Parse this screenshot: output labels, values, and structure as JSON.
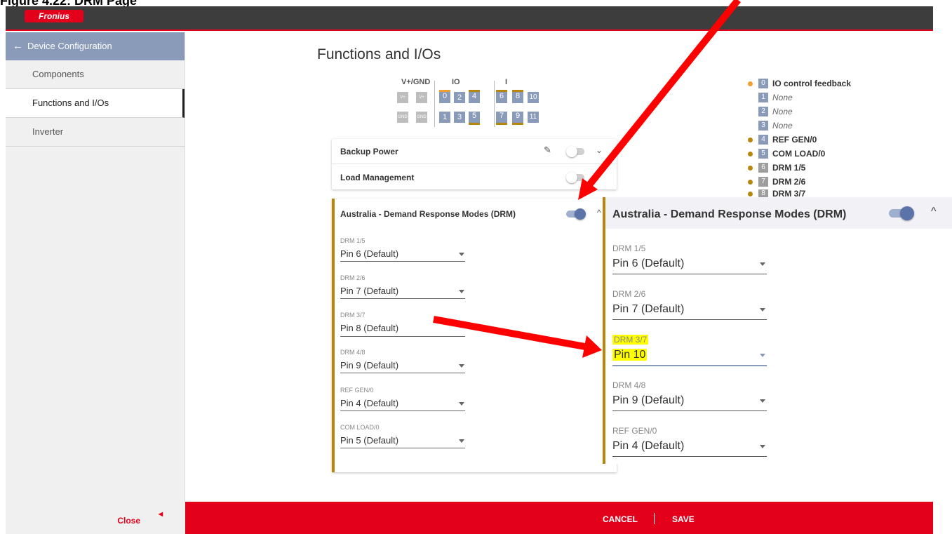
{
  "caption": "Figure 4.22: DRM Page",
  "brand": {
    "logo_text": "Fronius",
    "accent": "#e2001a",
    "header_bg": "#3d3d3d",
    "sidebar_header_bg": "#8a9ab9",
    "drm_border": "#b8860b"
  },
  "sidebar": {
    "header": "Device Configuration",
    "items": [
      {
        "label": "Components"
      },
      {
        "label": "Functions and I/Os"
      },
      {
        "label": "Inverter"
      }
    ],
    "close_label": "Close"
  },
  "main": {
    "title": "Functions and I/Os",
    "pin_grid": {
      "labels": [
        "V+/GND",
        "IO",
        "I"
      ],
      "top_row": [
        "V+",
        "V+",
        "0",
        "2",
        "4",
        "6",
        "8",
        "10"
      ],
      "bottom_row": [
        "GND",
        "GND",
        "1",
        "3",
        "5",
        "7",
        "9",
        "11"
      ]
    },
    "cards": {
      "backup_power": "Backup Power",
      "load_management": "Load Management"
    },
    "drm": {
      "title": "Australia - Demand Response Modes (DRM)",
      "enabled": true,
      "fields": [
        {
          "label": "DRM 1/5",
          "value": "Pin 6 (Default)"
        },
        {
          "label": "DRM 2/6",
          "value": "Pin 7 (Default)"
        },
        {
          "label": "DRM 3/7",
          "value": "Pin 8 (Default)"
        },
        {
          "label": "DRM 4/8",
          "value": "Pin 9 (Default)"
        },
        {
          "label": "REF GEN/0",
          "value": "Pin 4 (Default)"
        },
        {
          "label": "COM LOAD/0",
          "value": "Pin 5 (Default)"
        }
      ]
    },
    "legend": [
      {
        "num": "0",
        "text": "IO control feedback",
        "dot": "#f0a030"
      },
      {
        "num": "1",
        "text": "None"
      },
      {
        "num": "2",
        "text": "None"
      },
      {
        "num": "3",
        "text": "None"
      },
      {
        "num": "4",
        "text": "REF GEN/0",
        "dot": "#b8860b"
      },
      {
        "num": "5",
        "text": "COM LOAD/0",
        "dot": "#b8860b"
      },
      {
        "num": "6",
        "text": "DRM 1/5",
        "dot": "#b8860b"
      },
      {
        "num": "7",
        "text": "DRM 2/6",
        "dot": "#b8860b"
      },
      {
        "num": "8",
        "text": "DRM 3/7",
        "dot": "#b8860b"
      }
    ]
  },
  "zoom": {
    "title": "Australia - Demand Response Modes (DRM)",
    "fields": [
      {
        "label": "DRM 1/5",
        "value": "Pin 6 (Default)"
      },
      {
        "label": "DRM 2/6",
        "value": "Pin 7 (Default)"
      },
      {
        "label": "DRM 3/7",
        "value": "Pin 10",
        "highlighted": true
      },
      {
        "label": "DRM 4/8",
        "value": "Pin 9 (Default)"
      },
      {
        "label": "REF GEN/0",
        "value": "Pin 4 (Default)"
      }
    ]
  },
  "footer": {
    "cancel": "CANCEL",
    "save": "SAVE"
  }
}
